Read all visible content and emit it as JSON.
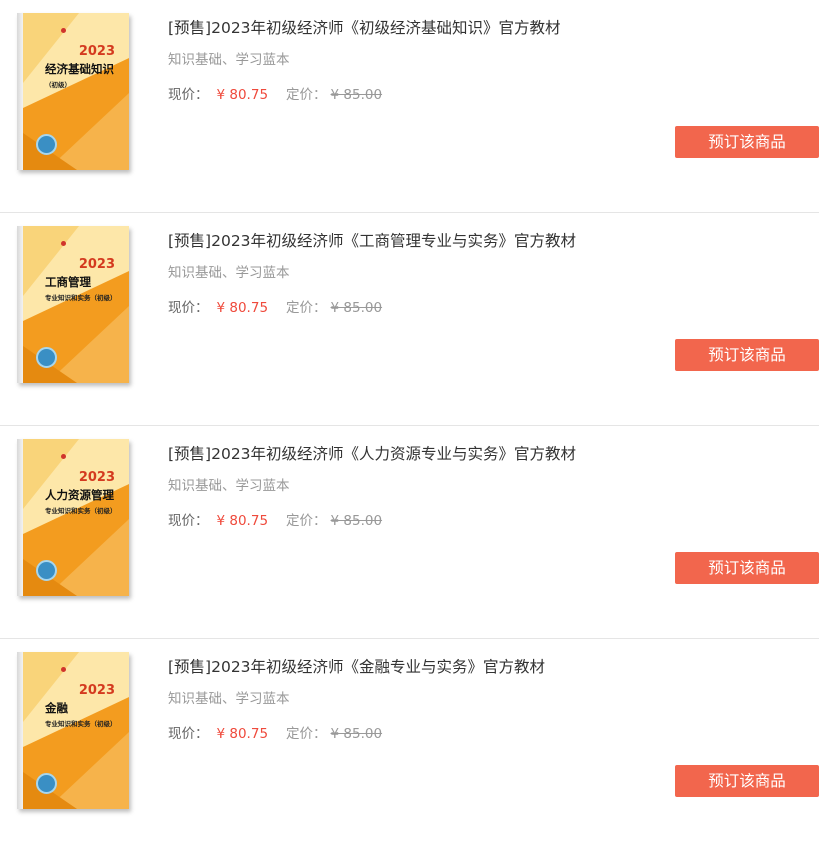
{
  "products": [
    {
      "title": "[预售]2023年初级经济师《初级经济基础知识》官方教材",
      "tags": "知识基础、学习蓝本",
      "price_label": "现价：",
      "current_price": "¥ 80.75",
      "list_price_label": "定价：",
      "list_price": "¥ 85.00",
      "button_label": "预订该商品",
      "cover": {
        "year": "2023",
        "name": "经济基础知识",
        "sub": "（初级）"
      }
    },
    {
      "title": "[预售]2023年初级经济师《工商管理专业与实务》官方教材",
      "tags": "知识基础、学习蓝本",
      "price_label": "现价：",
      "current_price": "¥ 80.75",
      "list_price_label": "定价：",
      "list_price": "¥ 85.00",
      "button_label": "预订该商品",
      "cover": {
        "year": "2023",
        "name": "工商管理",
        "sub": "专业知识和实务（初级）"
      }
    },
    {
      "title": "[预售]2023年初级经济师《人力资源专业与实务》官方教材",
      "tags": "知识基础、学习蓝本",
      "price_label": "现价：",
      "current_price": "¥ 80.75",
      "list_price_label": "定价：",
      "list_price": "¥ 85.00",
      "button_label": "预订该商品",
      "cover": {
        "year": "2023",
        "name": "人力资源管理",
        "sub": "专业知识和实务（初级）"
      }
    },
    {
      "title": "[预售]2023年初级经济师《金融专业与实务》官方教材",
      "tags": "知识基础、学习蓝本",
      "price_label": "现价：",
      "current_price": "¥ 80.75",
      "list_price_label": "定价：",
      "list_price": "¥ 85.00",
      "button_label": "预订该商品",
      "cover": {
        "year": "2023",
        "name": "金融",
        "sub": "专业知识和实务（初级）"
      }
    }
  ],
  "colors": {
    "accent_button": "#f2664d",
    "current_price": "#ef4a3c",
    "muted_text": "#999999"
  }
}
